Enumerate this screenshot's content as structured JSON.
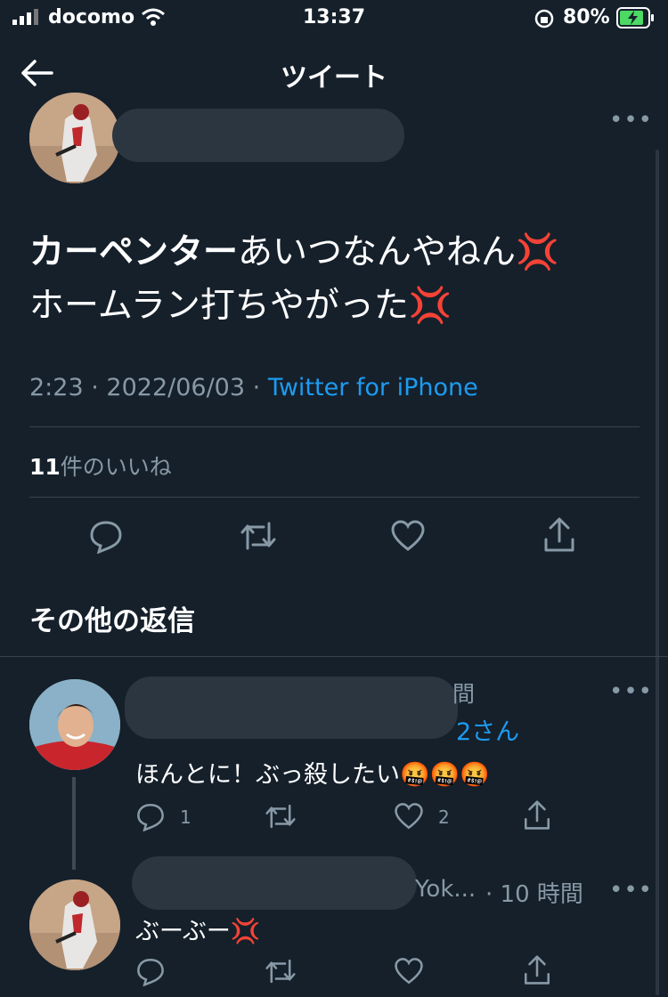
{
  "status_bar": {
    "carrier": "docomo",
    "time": "13:37",
    "battery": "80%"
  },
  "header": {
    "title": "ツイート"
  },
  "tweet": {
    "text_bold": "カーペンター",
    "text_line1_rest": "あいつなんやねん",
    "text_line2": "ホームラン打ちやがった",
    "emoji": "💢",
    "time": "2:23",
    "date": "2022/06/03",
    "separator": "·",
    "source": "Twitter for iPhone",
    "likes_count": "11",
    "likes_label": "件のいいね"
  },
  "section_title": "その他の返信",
  "replies": [
    {
      "meta_right": "間",
      "reply_to_tail": "2さん",
      "text": "ほんとに！ぶっ殺したい",
      "emoji": "🤬🤬🤬",
      "reply_count": "1",
      "like_count": "2"
    },
    {
      "handle_partial": "Yok...",
      "time": "· 10 時間",
      "text": "ぶーぶー",
      "emoji": "💢"
    }
  ],
  "icons": {
    "back": "arrow-left-icon",
    "more": "more-dots-icon",
    "reply": "reply-icon",
    "retweet": "retweet-icon",
    "like": "heart-icon",
    "share": "share-icon"
  },
  "colors": {
    "background": "#15202b",
    "accent": "#1d9bf0",
    "muted": "#8899a6",
    "divider": "#38444d",
    "battery_charge": "#4cd964"
  }
}
